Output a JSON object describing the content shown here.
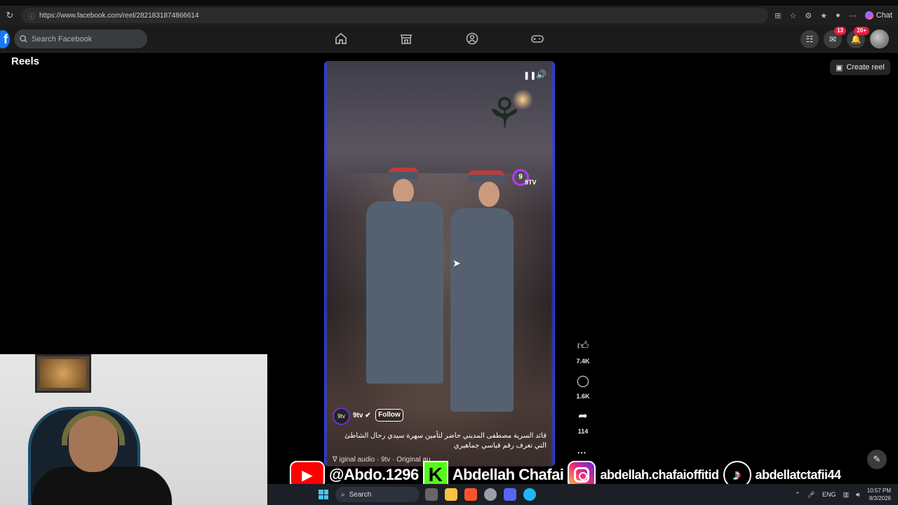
{
  "browser": {
    "url": "https://www.facebook.com/reel/2821831874866614",
    "chat_label": "Chat"
  },
  "facebook": {
    "logo": "f",
    "search_placeholder": "Search Facebook",
    "messenger_badge": "13",
    "notifications_badge": "20+",
    "page_title": "Reels",
    "create_reel_label": "Create reel"
  },
  "reel": {
    "channel_name": "9tv",
    "channel_avatar_text": "9tv",
    "watermark": "9TV",
    "follow_label": "Follow",
    "caption": "قائد السرية مصطفى المديني حاضر لتأمين سهرة سيدي رحال الشاطئ التي تعرف رقم قياسي جماهيري",
    "audio": "iginal audio · 9tv · Original au",
    "likes": "7.4K",
    "comments": "1.6K",
    "shares": "114",
    "more": "···"
  },
  "overlay": {
    "youtube_handle": "@Abdo.1296",
    "kick_name": "Abdellah Chafai",
    "instagram_handle": "abdellah.chafaioffitid",
    "tiktok_handle": "abdellatctafii44"
  },
  "taskbar": {
    "search_label": "Search",
    "language": "ENG",
    "time": "10:57 PM",
    "date": "8/3/2026"
  },
  "colors": {
    "facebook_blue": "#1877f2",
    "badge_red": "#e41e3f",
    "youtube_red": "#ff0000",
    "kick_green": "#53fc18"
  }
}
